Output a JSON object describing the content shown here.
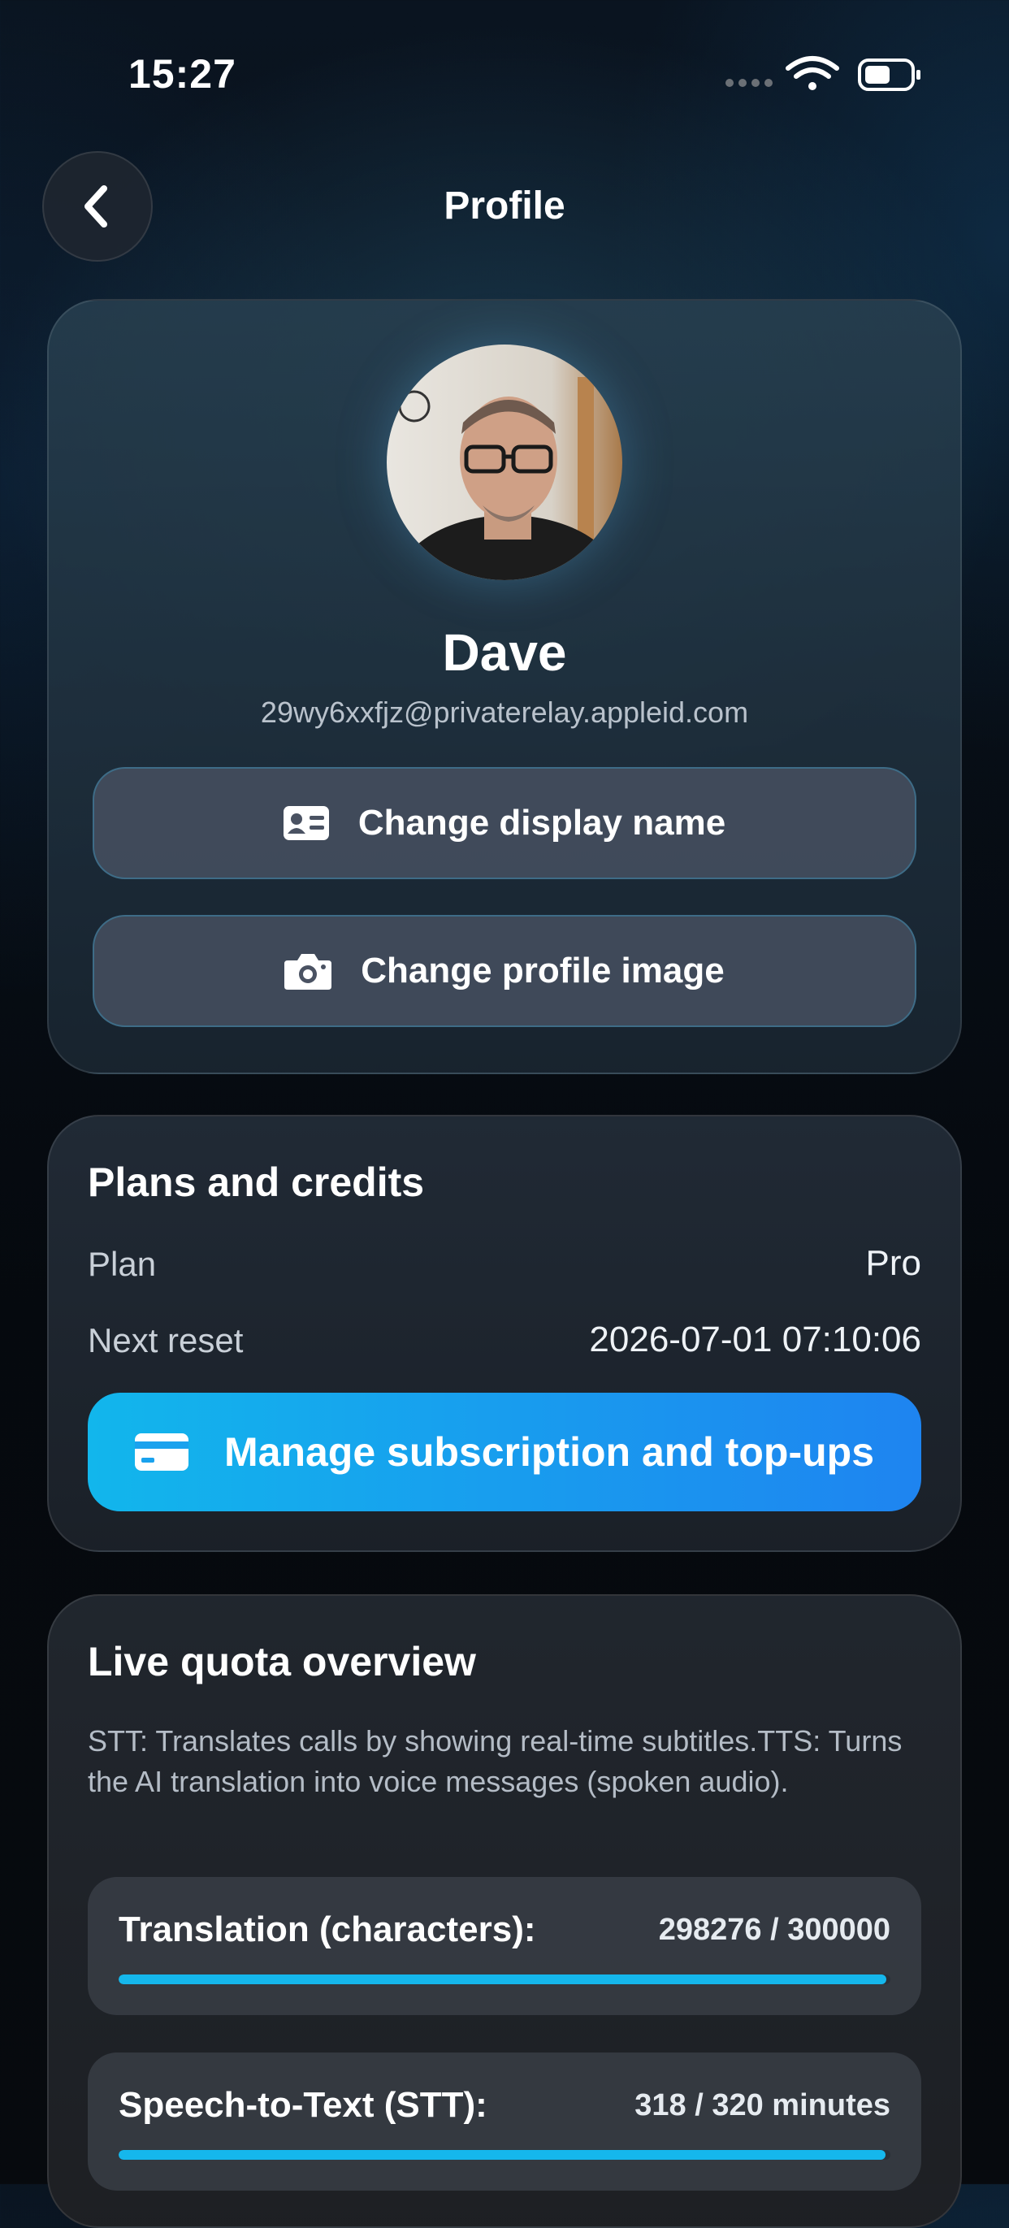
{
  "status_bar": {
    "time": "15:27"
  },
  "header": {
    "title": "Profile"
  },
  "profile": {
    "name": "Dave",
    "email": "29wy6xxfjz@privaterelay.appleid.com",
    "change_name_label": "Change display name",
    "change_image_label": "Change profile image"
  },
  "plans": {
    "title": "Plans and credits",
    "plan_label": "Plan",
    "plan_value": "Pro",
    "reset_label": "Next reset",
    "reset_value": "2026-07-01 07:10:06",
    "manage_label": "Manage subscription and top-ups"
  },
  "quota": {
    "title": "Live quota overview",
    "description": "STT: Translates calls by showing real-time subtitles.TTS: Turns the AI translation into voice messages (spoken audio).",
    "items": [
      {
        "label": "Translation (characters):",
        "value": "298276 / 300000",
        "used": 298276,
        "total": 300000
      },
      {
        "label": "Speech-to-Text (STT):",
        "value": "318 / 320 minutes",
        "used": 318,
        "total": 320
      }
    ]
  },
  "colors": {
    "accent": "#15b7ec",
    "accent_end": "#1e84f0"
  },
  "icons": [
    "back-chevron-icon",
    "signal-icon",
    "wifi-icon",
    "battery-icon",
    "contact-card-icon",
    "camera-icon",
    "credit-card-icon"
  ]
}
